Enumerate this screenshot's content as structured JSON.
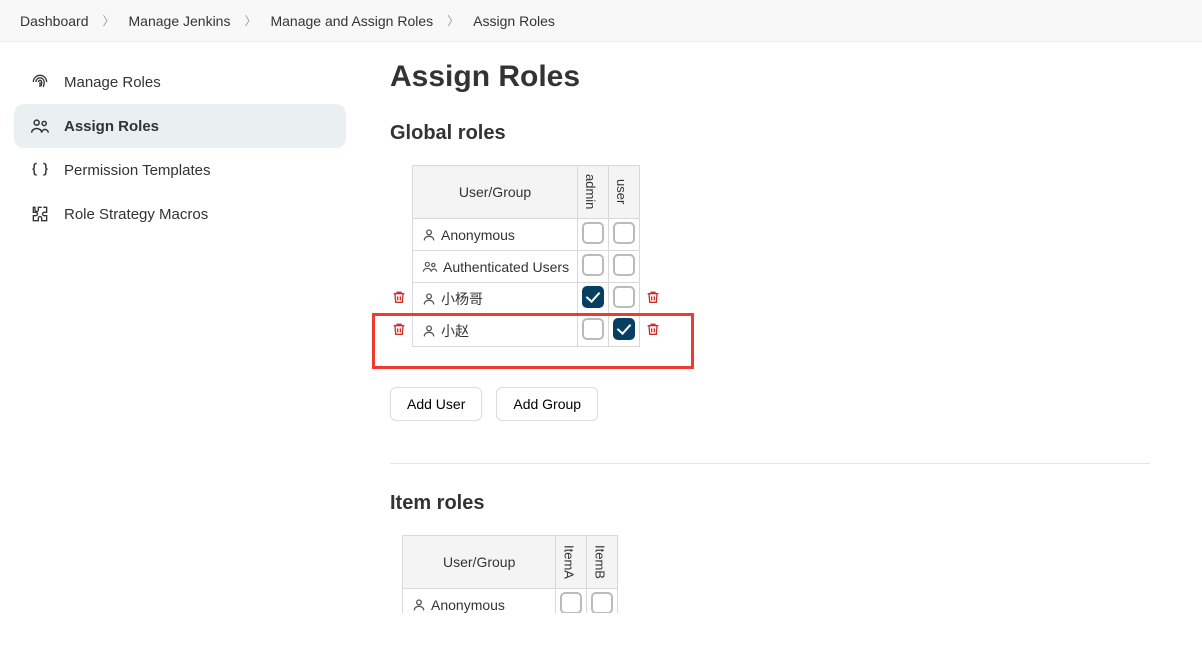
{
  "breadcrumb": [
    {
      "label": "Dashboard"
    },
    {
      "label": "Manage Jenkins"
    },
    {
      "label": "Manage and Assign Roles"
    },
    {
      "label": "Assign Roles"
    }
  ],
  "sidebar": {
    "items": [
      {
        "label": "Manage Roles"
      },
      {
        "label": "Assign Roles"
      },
      {
        "label": "Permission Templates"
      },
      {
        "label": "Role Strategy Macros"
      }
    ]
  },
  "page": {
    "title": "Assign Roles",
    "global": {
      "heading": "Global roles",
      "user_group_header": "User/Group",
      "roles": [
        "admin",
        "user"
      ],
      "rows": [
        {
          "label": "Anonymous",
          "icon": "person",
          "admin": false,
          "user": false,
          "deletable": false
        },
        {
          "label": "Authenticated Users",
          "icon": "group",
          "admin": false,
          "user": false,
          "deletable": false
        },
        {
          "label": "小杨哥",
          "icon": "person",
          "admin": true,
          "user": false,
          "deletable": true
        },
        {
          "label": "小赵",
          "icon": "person",
          "admin": false,
          "user": true,
          "deletable": true
        }
      ],
      "add_user": "Add User",
      "add_group": "Add Group"
    },
    "item": {
      "heading": "Item roles",
      "user_group_header": "User/Group",
      "roles": [
        "ItemA",
        "ItemB"
      ],
      "rows": [
        {
          "label": "Anonymous",
          "icon": "person",
          "ItemA": false,
          "ItemB": false,
          "deletable": false
        }
      ]
    }
  }
}
